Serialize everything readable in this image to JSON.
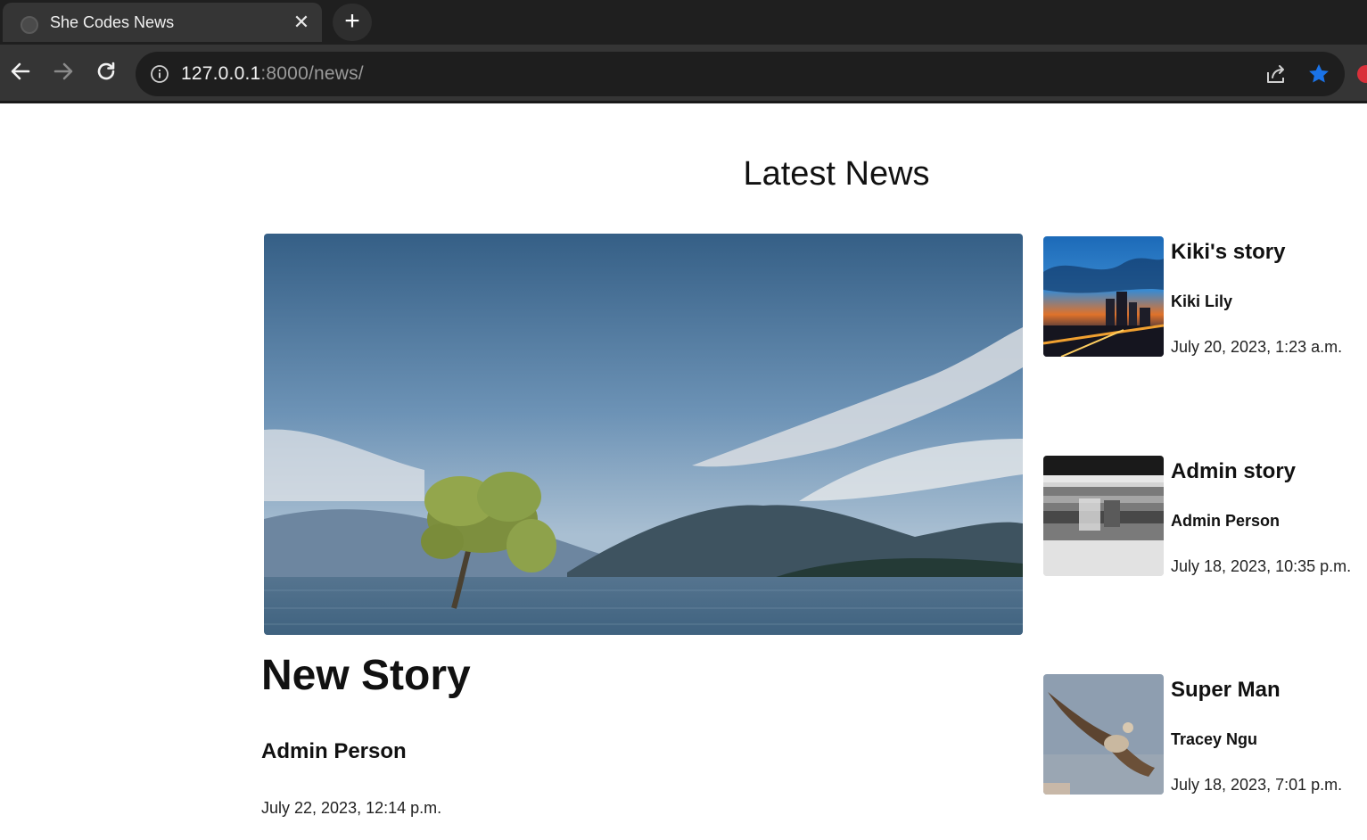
{
  "browser": {
    "tab_title": "She Codes News",
    "url_host": "127.0.0.1",
    "url_rest": ":8000/news/",
    "accent_color": "#1a73e8"
  },
  "page": {
    "title": "Latest News"
  },
  "featured": {
    "title": "New Story",
    "author": "Admin Person",
    "date": "July 22, 2023, 12:14 p.m.",
    "image": "lake-tree-mountains"
  },
  "stories": [
    {
      "title": "Kiki's story",
      "author": "Kiki Lily",
      "date": "July 20, 2023, 1:23 a.m.",
      "image": "city-skyline-sunset"
    },
    {
      "title": "Admin story",
      "author": "Admin Person",
      "date": "July 18, 2023, 10:35 p.m.",
      "image": "subway-motion-blur"
    },
    {
      "title": "Super Man",
      "author": "Tracey Ngu",
      "date": "July 18, 2023, 7:01 p.m.",
      "image": "flying-vulture"
    }
  ]
}
